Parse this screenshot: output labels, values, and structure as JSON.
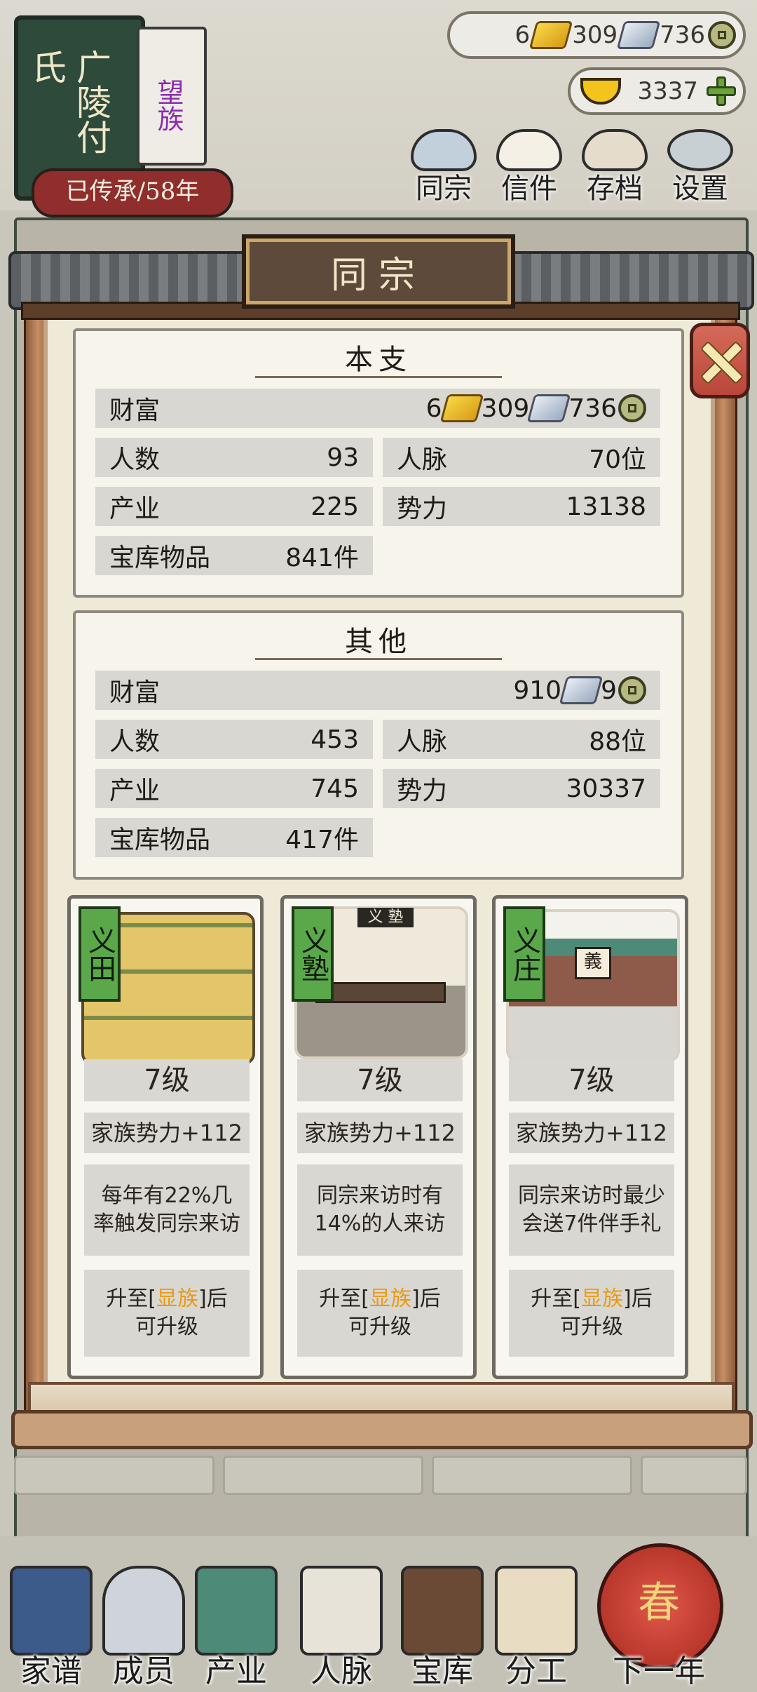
{
  "family": {
    "name": "广陵付氏",
    "tag": "望族",
    "heritage": "已传承/58年"
  },
  "currency": {
    "gold": "6",
    "silver": "309",
    "coin": "736",
    "ingot": "3337"
  },
  "top_nav": [
    {
      "label": "同宗",
      "icon": "clan-book-icon"
    },
    {
      "label": "信件",
      "icon": "letter-icon"
    },
    {
      "label": "存档",
      "icon": "save-scroll-icon"
    },
    {
      "label": "设置",
      "icon": "gear-icon"
    }
  ],
  "dialog": {
    "title": "同宗",
    "main": {
      "title": "本支",
      "wealth_label": "财富",
      "wealth_gold": "6",
      "wealth_silver": "309",
      "wealth_coin": "736",
      "people_label": "人数",
      "people": "93",
      "contacts_label": "人脉",
      "contacts": "70位",
      "industry_label": "产业",
      "industry": "225",
      "power_label": "势力",
      "power": "13138",
      "vault_label": "宝库物品",
      "vault": "841件"
    },
    "other": {
      "title": "其他",
      "wealth_label": "财富",
      "wealth_silver": "910",
      "wealth_coin": "9",
      "people_label": "人数",
      "people": "453",
      "contacts_label": "人脉",
      "contacts": "88位",
      "industry_label": "产业",
      "industry": "745",
      "power_label": "势力",
      "power": "30337",
      "vault_label": "宝库物品",
      "vault": "417件"
    },
    "buildings": [
      {
        "tag": "义田",
        "level": "7级",
        "bonus": "家族势力+112",
        "desc": "每年有22%几率触发同宗来访",
        "upgrade_pre": "升至[",
        "upgrade_hl": "显族",
        "upgrade_post": "]后",
        "upgrade_line2": "可升级"
      },
      {
        "tag": "义塾",
        "level": "7级",
        "bonus": "家族势力+112",
        "desc": "同宗来访时有14%的人来访",
        "upgrade_pre": "升至[",
        "upgrade_hl": "显族",
        "upgrade_post": "]后",
        "upgrade_line2": "可升级"
      },
      {
        "tag": "义庄",
        "level": "7级",
        "bonus": "家族势力+112",
        "desc": "同宗来访时最少会送7件伴手礼",
        "upgrade_pre": "升至[",
        "upgrade_hl": "显族",
        "upgrade_post": "]后",
        "upgrade_line2": "可升级"
      }
    ],
    "school_plaque": "义 塾",
    "manor_plaque": "義"
  },
  "bottom_nav": [
    {
      "label": "家谱",
      "icon": "genealogy-book-icon"
    },
    {
      "label": "成员",
      "icon": "member-icon"
    },
    {
      "label": "产业",
      "icon": "building-icon"
    },
    {
      "label": "人脉",
      "icon": "network-icon"
    },
    {
      "label": "宝库",
      "icon": "treasure-chest-icon"
    },
    {
      "label": "分工",
      "icon": "scroll-icon"
    },
    {
      "label": "下一年",
      "icon": "lantern-icon"
    }
  ],
  "lantern_char": "春",
  "colors": {
    "highlight": "#e89a18",
    "tag_green": "#5aa84a",
    "heritage_red": "#8f2e2c"
  }
}
